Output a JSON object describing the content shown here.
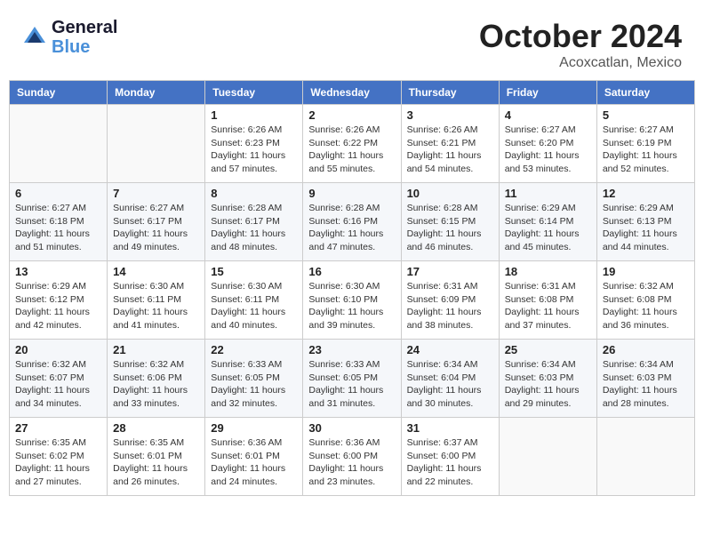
{
  "header": {
    "logo_line1": "General",
    "logo_line2": "Blue",
    "month": "October 2024",
    "location": "Acoxcatlan, Mexico"
  },
  "days_of_week": [
    "Sunday",
    "Monday",
    "Tuesday",
    "Wednesday",
    "Thursday",
    "Friday",
    "Saturday"
  ],
  "weeks": [
    [
      {
        "day": "",
        "info": ""
      },
      {
        "day": "",
        "info": ""
      },
      {
        "day": "1",
        "info": "Sunrise: 6:26 AM\nSunset: 6:23 PM\nDaylight: 11 hours and 57 minutes."
      },
      {
        "day": "2",
        "info": "Sunrise: 6:26 AM\nSunset: 6:22 PM\nDaylight: 11 hours and 55 minutes."
      },
      {
        "day": "3",
        "info": "Sunrise: 6:26 AM\nSunset: 6:21 PM\nDaylight: 11 hours and 54 minutes."
      },
      {
        "day": "4",
        "info": "Sunrise: 6:27 AM\nSunset: 6:20 PM\nDaylight: 11 hours and 53 minutes."
      },
      {
        "day": "5",
        "info": "Sunrise: 6:27 AM\nSunset: 6:19 PM\nDaylight: 11 hours and 52 minutes."
      }
    ],
    [
      {
        "day": "6",
        "info": "Sunrise: 6:27 AM\nSunset: 6:18 PM\nDaylight: 11 hours and 51 minutes."
      },
      {
        "day": "7",
        "info": "Sunrise: 6:27 AM\nSunset: 6:17 PM\nDaylight: 11 hours and 49 minutes."
      },
      {
        "day": "8",
        "info": "Sunrise: 6:28 AM\nSunset: 6:17 PM\nDaylight: 11 hours and 48 minutes."
      },
      {
        "day": "9",
        "info": "Sunrise: 6:28 AM\nSunset: 6:16 PM\nDaylight: 11 hours and 47 minutes."
      },
      {
        "day": "10",
        "info": "Sunrise: 6:28 AM\nSunset: 6:15 PM\nDaylight: 11 hours and 46 minutes."
      },
      {
        "day": "11",
        "info": "Sunrise: 6:29 AM\nSunset: 6:14 PM\nDaylight: 11 hours and 45 minutes."
      },
      {
        "day": "12",
        "info": "Sunrise: 6:29 AM\nSunset: 6:13 PM\nDaylight: 11 hours and 44 minutes."
      }
    ],
    [
      {
        "day": "13",
        "info": "Sunrise: 6:29 AM\nSunset: 6:12 PM\nDaylight: 11 hours and 42 minutes."
      },
      {
        "day": "14",
        "info": "Sunrise: 6:30 AM\nSunset: 6:11 PM\nDaylight: 11 hours and 41 minutes."
      },
      {
        "day": "15",
        "info": "Sunrise: 6:30 AM\nSunset: 6:11 PM\nDaylight: 11 hours and 40 minutes."
      },
      {
        "day": "16",
        "info": "Sunrise: 6:30 AM\nSunset: 6:10 PM\nDaylight: 11 hours and 39 minutes."
      },
      {
        "day": "17",
        "info": "Sunrise: 6:31 AM\nSunset: 6:09 PM\nDaylight: 11 hours and 38 minutes."
      },
      {
        "day": "18",
        "info": "Sunrise: 6:31 AM\nSunset: 6:08 PM\nDaylight: 11 hours and 37 minutes."
      },
      {
        "day": "19",
        "info": "Sunrise: 6:32 AM\nSunset: 6:08 PM\nDaylight: 11 hours and 36 minutes."
      }
    ],
    [
      {
        "day": "20",
        "info": "Sunrise: 6:32 AM\nSunset: 6:07 PM\nDaylight: 11 hours and 34 minutes."
      },
      {
        "day": "21",
        "info": "Sunrise: 6:32 AM\nSunset: 6:06 PM\nDaylight: 11 hours and 33 minutes."
      },
      {
        "day": "22",
        "info": "Sunrise: 6:33 AM\nSunset: 6:05 PM\nDaylight: 11 hours and 32 minutes."
      },
      {
        "day": "23",
        "info": "Sunrise: 6:33 AM\nSunset: 6:05 PM\nDaylight: 11 hours and 31 minutes."
      },
      {
        "day": "24",
        "info": "Sunrise: 6:34 AM\nSunset: 6:04 PM\nDaylight: 11 hours and 30 minutes."
      },
      {
        "day": "25",
        "info": "Sunrise: 6:34 AM\nSunset: 6:03 PM\nDaylight: 11 hours and 29 minutes."
      },
      {
        "day": "26",
        "info": "Sunrise: 6:34 AM\nSunset: 6:03 PM\nDaylight: 11 hours and 28 minutes."
      }
    ],
    [
      {
        "day": "27",
        "info": "Sunrise: 6:35 AM\nSunset: 6:02 PM\nDaylight: 11 hours and 27 minutes."
      },
      {
        "day": "28",
        "info": "Sunrise: 6:35 AM\nSunset: 6:01 PM\nDaylight: 11 hours and 26 minutes."
      },
      {
        "day": "29",
        "info": "Sunrise: 6:36 AM\nSunset: 6:01 PM\nDaylight: 11 hours and 24 minutes."
      },
      {
        "day": "30",
        "info": "Sunrise: 6:36 AM\nSunset: 6:00 PM\nDaylight: 11 hours and 23 minutes."
      },
      {
        "day": "31",
        "info": "Sunrise: 6:37 AM\nSunset: 6:00 PM\nDaylight: 11 hours and 22 minutes."
      },
      {
        "day": "",
        "info": ""
      },
      {
        "day": "",
        "info": ""
      }
    ]
  ]
}
